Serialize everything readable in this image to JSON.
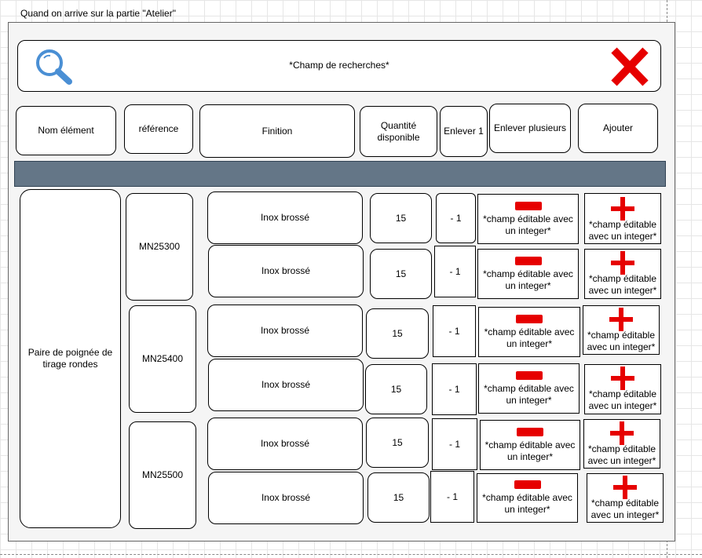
{
  "caption": "Quand on arrive sur la partie \"Atelier\"",
  "search": {
    "placeholder": "*Champ de recherches*"
  },
  "headers": {
    "name": "Nom élément",
    "reference": "référence",
    "finish": "Finition",
    "qty_available": "Quantité disponible",
    "remove_one": "Enlever 1",
    "remove_many": "Enlever plusieurs",
    "add": "Ajouter"
  },
  "item": {
    "name": "Paire de poignée de tirage rondes"
  },
  "references": [
    "MN25300",
    "MN25400",
    "MN25500"
  ],
  "rows": [
    {
      "finish": "Inox brossé",
      "qty": "15",
      "remove_one": "- 1",
      "remove_field": "*champ éditable avec un integer*",
      "add_field": "*champ éditable avec un integer*"
    },
    {
      "finish": "Inox brossé",
      "qty": "15",
      "remove_one": "- 1",
      "remove_field": "*champ éditable avec un integer*",
      "add_field": "*champ éditable avec un integer*"
    },
    {
      "finish": "Inox brossé",
      "qty": "15",
      "remove_one": "- 1",
      "remove_field": "*champ éditable avec un integer*",
      "add_field": "*champ éditable avec un integer*"
    },
    {
      "finish": "Inox brossé",
      "qty": "15",
      "remove_one": "- 1",
      "remove_field": "*champ éditable avec un integer*",
      "add_field": "*champ éditable avec un integer*"
    },
    {
      "finish": "Inox brossé",
      "qty": "15",
      "remove_one": "- 1",
      "remove_field": "*champ éditable avec un integer*",
      "add_field": "*champ éditable avec un integer*"
    },
    {
      "finish": "Inox brossé",
      "qty": "15",
      "remove_one": "- 1",
      "remove_field": "*champ éditable avec un integer*",
      "add_field": "*champ éditable avec un integer*"
    }
  ],
  "colors": {
    "accent_red": "#e60000",
    "header_bar": "#647687",
    "search_icon": "#4a8fd4"
  },
  "icons": [
    "search-icon",
    "close-icon",
    "minus-icon",
    "plus-icon"
  ]
}
